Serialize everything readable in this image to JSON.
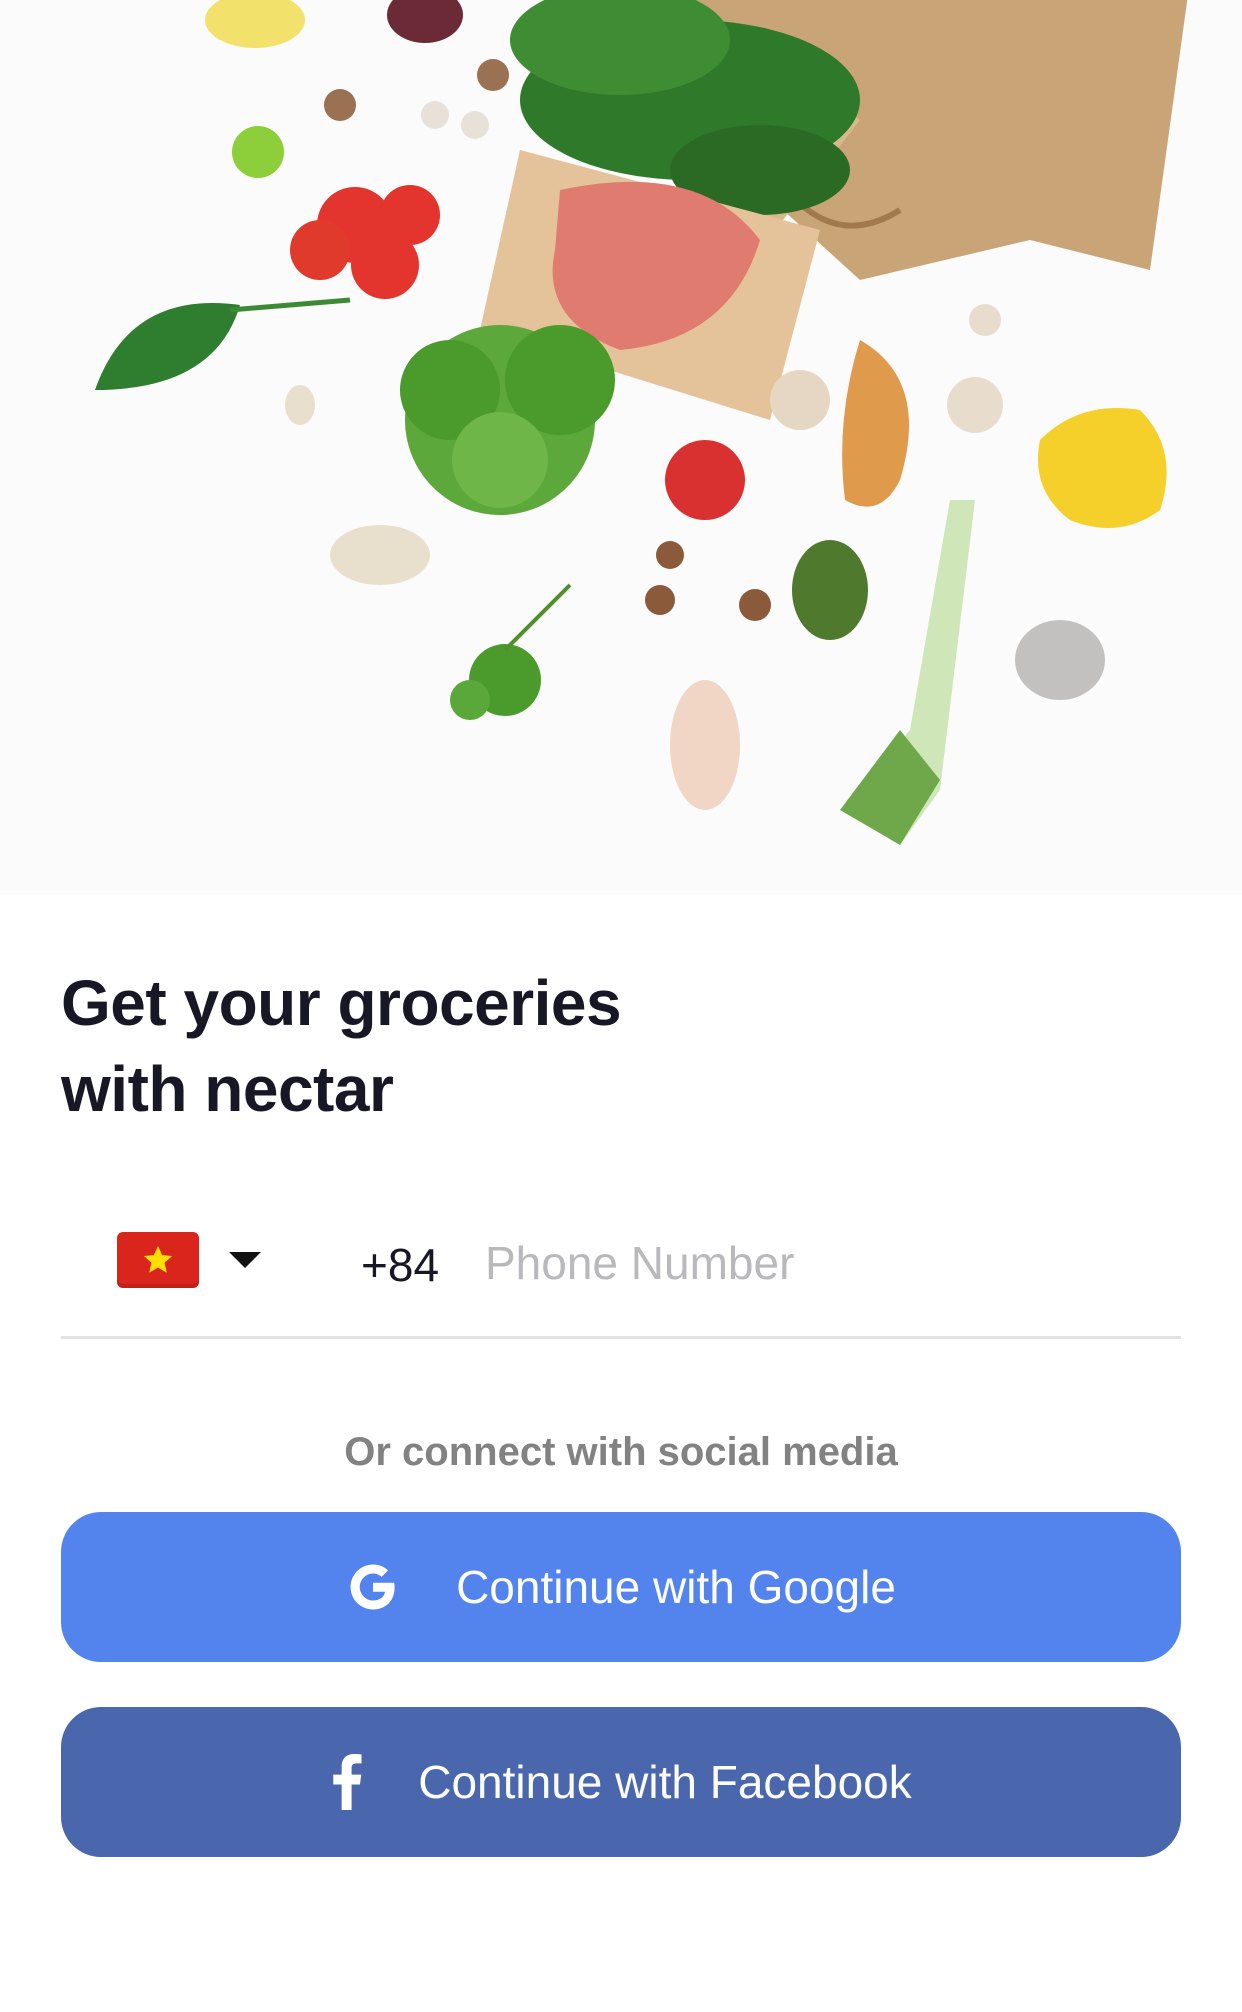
{
  "hero": {
    "image_alt": "groceries-paper-bag-illustration"
  },
  "heading": {
    "line1": "Get your groceries",
    "line2": "with nectar"
  },
  "phone": {
    "country_flag": "vietnam-flag-icon",
    "dial_code": "+84",
    "placeholder": "Phone Number",
    "value": ""
  },
  "social": {
    "caption": "Or connect with social media",
    "google_label": "Continue with Google",
    "facebook_label": "Continue with Facebook",
    "google_color": "#5383EC",
    "facebook_color": "#4A66AC"
  }
}
